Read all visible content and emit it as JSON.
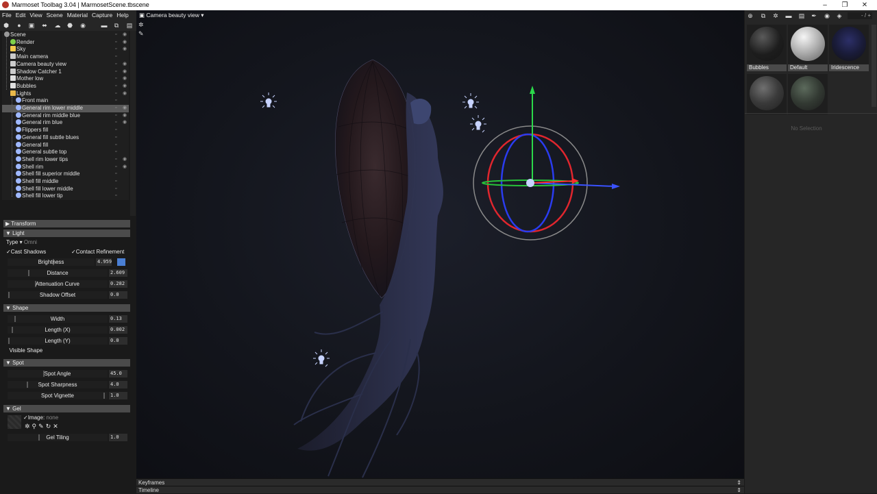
{
  "window": {
    "title": "Marmoset Toolbag 3.04 | MarmosetScene.tbscene",
    "min": "–",
    "restore": "❐",
    "close": "✕"
  },
  "menu": [
    "File",
    "Edit",
    "View",
    "Scene",
    "Material",
    "Capture",
    "Help"
  ],
  "outliner": {
    "items": [
      {
        "label": "Scene",
        "icon": "scene-icon",
        "eye": true,
        "selected": false
      },
      {
        "label": "Render",
        "icon": "render-gear-icon",
        "eye": true,
        "selected": false
      },
      {
        "label": "Sky",
        "icon": "sky-icon",
        "eye": true,
        "selected": false
      },
      {
        "label": "Main camera",
        "icon": "camera-icon",
        "eye": false,
        "selected": false
      },
      {
        "label": "Camera beauty view",
        "icon": "camera-icon",
        "eye": true,
        "selected": false
      },
      {
        "label": "Shadow Catcher 1",
        "icon": "shadow-catcher-icon",
        "eye": true,
        "selected": false
      },
      {
        "label": "Mother low",
        "icon": "mesh-icon",
        "eye": true,
        "selected": false
      },
      {
        "label": "Bubbles",
        "icon": "mesh-icon",
        "eye": true,
        "selected": false
      },
      {
        "label": "Lights",
        "icon": "folder-icon",
        "eye": true,
        "selected": false
      },
      {
        "label": "Front main",
        "icon": "light-bulb-icon",
        "eye": false,
        "selected": false
      },
      {
        "label": "General rim lower middle",
        "icon": "light-bulb-icon",
        "eye": true,
        "selected": true
      },
      {
        "label": "General rim middle blue",
        "icon": "light-bulb-icon",
        "eye": true,
        "selected": false
      },
      {
        "label": "General rim blue",
        "icon": "light-bulb-icon",
        "eye": true,
        "selected": false
      },
      {
        "label": "Flippers fill",
        "icon": "light-bulb-icon",
        "eye": false,
        "selected": false
      },
      {
        "label": "General fill subtle blues",
        "icon": "light-bulb-icon",
        "eye": false,
        "selected": false
      },
      {
        "label": "General fill",
        "icon": "light-bulb-icon",
        "eye": false,
        "selected": false
      },
      {
        "label": "General subtle top",
        "icon": "light-bulb-icon",
        "eye": false,
        "selected": false
      },
      {
        "label": "Shell rim lower tips",
        "icon": "light-bulb-icon",
        "eye": true,
        "selected": false
      },
      {
        "label": "Shell rim",
        "icon": "light-bulb-icon",
        "eye": true,
        "selected": false
      },
      {
        "label": "Shell fill superior middle",
        "icon": "light-bulb-icon",
        "eye": false,
        "selected": false
      },
      {
        "label": "Shell fill middle",
        "icon": "light-bulb-icon",
        "eye": false,
        "selected": false
      },
      {
        "label": "Shell fill lower middle",
        "icon": "light-bulb-icon",
        "eye": false,
        "selected": false
      },
      {
        "label": "Shell fill lower tip",
        "icon": "light-bulb-icon",
        "eye": false,
        "selected": false
      }
    ]
  },
  "properties": {
    "transform": "Transform",
    "light": {
      "title": "Light",
      "type_label": "Type",
      "type_value": "Omni",
      "cast_shadows": "Cast Shadows",
      "contact_refinement": "Contact Refinement",
      "brightness": {
        "label": "Brightness",
        "value": "4.959",
        "color": "#4a7fd4"
      },
      "distance": {
        "label": "Distance",
        "value": "2.609"
      },
      "attenuation": {
        "label": "Attenuation Curve",
        "value": "0.282"
      },
      "shadow_offset": {
        "label": "Shadow Offset",
        "value": "0.0"
      }
    },
    "shape": {
      "title": "Shape",
      "width": {
        "label": "Width",
        "value": "0.13"
      },
      "length_x": {
        "label": "Length (X)",
        "value": "0.002"
      },
      "length_y": {
        "label": "Length (Y)",
        "value": "0.0"
      },
      "visible_shape": "Visible Shape"
    },
    "spot": {
      "title": "Spot",
      "angle": {
        "label": "Spot Angle",
        "value": "45.0"
      },
      "sharpness": {
        "label": "Spot Sharpness",
        "value": "4.0"
      },
      "vignette": {
        "label": "Spot Vignette",
        "value": "1.0"
      }
    },
    "gel": {
      "title": "Gel",
      "image_label": "Image:",
      "image_value": "none",
      "tiling": {
        "label": "Gel Tiling",
        "value": "1.0"
      }
    }
  },
  "viewport": {
    "camera": "Camera beauty view"
  },
  "bottom": {
    "keyframes": "Keyframes",
    "timeline": "Timeline"
  },
  "materials": {
    "zoom": "- / +",
    "items": [
      {
        "label": "Bubbles"
      },
      {
        "label": "Default"
      },
      {
        "label": "Iridescence"
      },
      {
        "label": ""
      },
      {
        "label": ""
      }
    ],
    "no_selection": "No Selection"
  }
}
